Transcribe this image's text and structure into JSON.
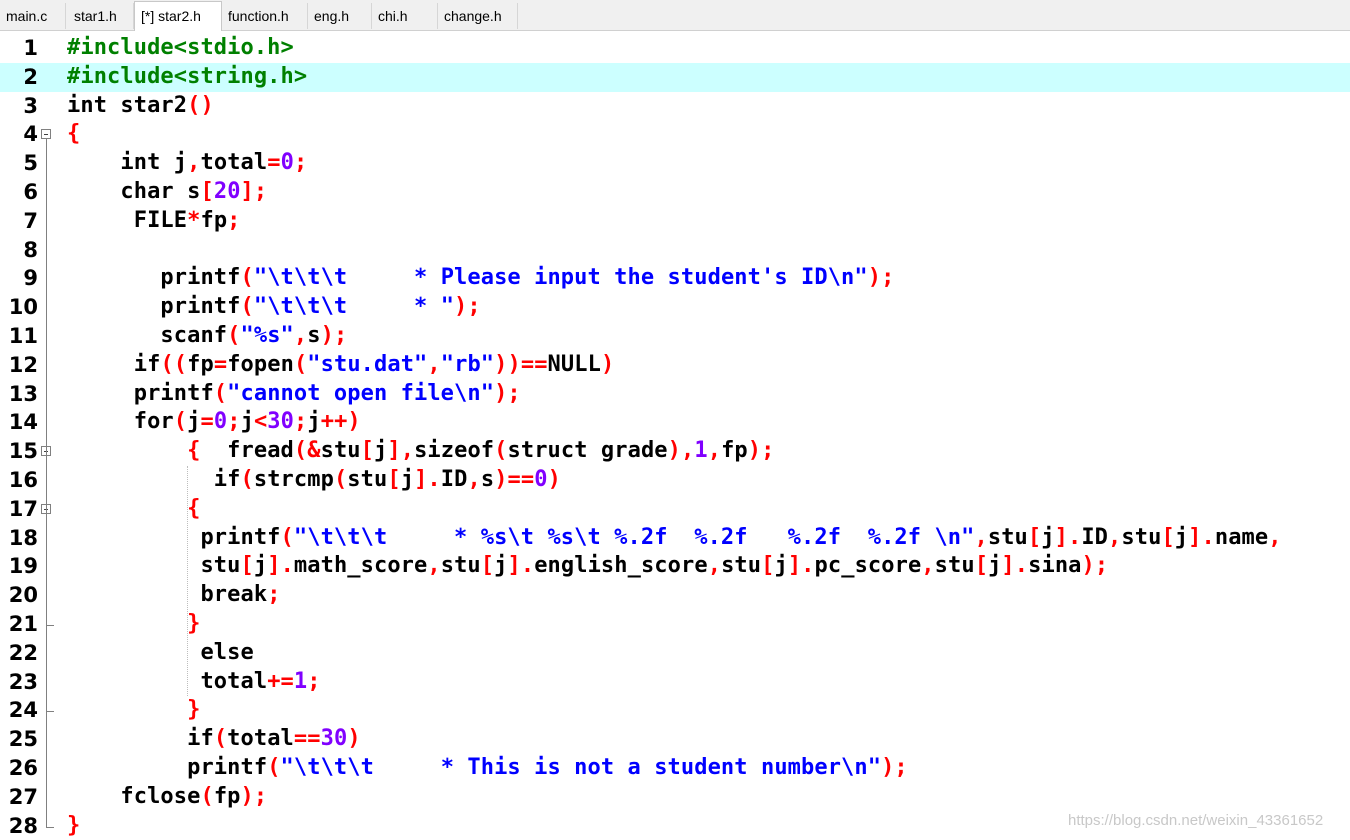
{
  "tabs": [
    {
      "label": "main.c"
    },
    {
      "label": "star1.h"
    },
    {
      "label": "[*] star2.h"
    },
    {
      "label": "function.h"
    },
    {
      "label": "eng.h"
    },
    {
      "label": "chi.h"
    },
    {
      "label": "change.h"
    }
  ],
  "active_tab": 2,
  "highlighted_line": 2,
  "colors": {
    "preprocessor": "#008000",
    "keyword": "#000000",
    "operator": "#ff0000",
    "number": "#8000ff",
    "string": "#0000ff",
    "current_line_bg": "#ccffff"
  },
  "code_lines": [
    {
      "n": "1",
      "tokens": [
        [
          "pp",
          "#include<stdio.h>"
        ]
      ]
    },
    {
      "n": "2",
      "tokens": [
        [
          "pp",
          "#include<string.h>"
        ]
      ]
    },
    {
      "n": "3",
      "tokens": [
        [
          "kw",
          "int"
        ],
        [
          "id",
          " star2"
        ],
        [
          "op",
          "()"
        ]
      ]
    },
    {
      "n": "4",
      "tokens": [
        [
          "op",
          "{"
        ]
      ]
    },
    {
      "n": "5",
      "tokens": [
        [
          "id",
          "    "
        ],
        [
          "kw",
          "int"
        ],
        [
          "id",
          " j"
        ],
        [
          "op",
          ","
        ],
        [
          "id",
          "total"
        ],
        [
          "op",
          "="
        ],
        [
          "num",
          "0"
        ],
        [
          "op",
          ";"
        ]
      ]
    },
    {
      "n": "6",
      "tokens": [
        [
          "id",
          "    "
        ],
        [
          "kw",
          "char"
        ],
        [
          "id",
          " s"
        ],
        [
          "op",
          "["
        ],
        [
          "num",
          "20"
        ],
        [
          "op",
          "];"
        ]
      ]
    },
    {
      "n": "7",
      "tokens": [
        [
          "id",
          "     FILE"
        ],
        [
          "op",
          "*"
        ],
        [
          "id",
          "fp"
        ],
        [
          "op",
          ";"
        ]
      ]
    },
    {
      "n": "8",
      "tokens": []
    },
    {
      "n": "9",
      "tokens": [
        [
          "id",
          "       printf"
        ],
        [
          "op",
          "("
        ],
        [
          "str",
          "\"\\t\\t\\t     * Please input the student's ID\\n\""
        ],
        [
          "op",
          ");"
        ]
      ]
    },
    {
      "n": "10",
      "tokens": [
        [
          "id",
          "       printf"
        ],
        [
          "op",
          "("
        ],
        [
          "str",
          "\"\\t\\t\\t     * \""
        ],
        [
          "op",
          ");"
        ]
      ]
    },
    {
      "n": "11",
      "tokens": [
        [
          "id",
          "       scanf"
        ],
        [
          "op",
          "("
        ],
        [
          "str",
          "\"%s\""
        ],
        [
          "op",
          ","
        ],
        [
          "id",
          "s"
        ],
        [
          "op",
          ");"
        ]
      ]
    },
    {
      "n": "12",
      "tokens": [
        [
          "id",
          "     "
        ],
        [
          "kw",
          "if"
        ],
        [
          "op",
          "(("
        ],
        [
          "id",
          "fp"
        ],
        [
          "op",
          "="
        ],
        [
          "id",
          "fopen"
        ],
        [
          "op",
          "("
        ],
        [
          "str",
          "\"stu.dat\""
        ],
        [
          "op",
          ","
        ],
        [
          "str",
          "\"rb\""
        ],
        [
          "op",
          "))=="
        ],
        [
          "id",
          "NULL"
        ],
        [
          "op",
          ")"
        ]
      ]
    },
    {
      "n": "13",
      "tokens": [
        [
          "id",
          "     printf"
        ],
        [
          "op",
          "("
        ],
        [
          "str",
          "\"cannot open file\\n\""
        ],
        [
          "op",
          ");"
        ]
      ]
    },
    {
      "n": "14",
      "tokens": [
        [
          "id",
          "     "
        ],
        [
          "kw",
          "for"
        ],
        [
          "op",
          "("
        ],
        [
          "id",
          "j"
        ],
        [
          "op",
          "="
        ],
        [
          "num",
          "0"
        ],
        [
          "op",
          ";"
        ],
        [
          "id",
          "j"
        ],
        [
          "op",
          "<"
        ],
        [
          "num",
          "30"
        ],
        [
          "op",
          ";"
        ],
        [
          "id",
          "j"
        ],
        [
          "op",
          "++)"
        ]
      ]
    },
    {
      "n": "15",
      "tokens": [
        [
          "id",
          "         "
        ],
        [
          "op",
          "{"
        ],
        [
          "id",
          "  fread"
        ],
        [
          "op",
          "(&"
        ],
        [
          "id",
          "stu"
        ],
        [
          "op",
          "["
        ],
        [
          "id",
          "j"
        ],
        [
          "op",
          "],"
        ],
        [
          "kw",
          "sizeof"
        ],
        [
          "op",
          "("
        ],
        [
          "kw",
          "struct"
        ],
        [
          "id",
          " grade"
        ],
        [
          "op",
          "),"
        ],
        [
          "num",
          "1"
        ],
        [
          "op",
          ","
        ],
        [
          "id",
          "fp"
        ],
        [
          "op",
          ");"
        ]
      ]
    },
    {
      "n": "16",
      "tokens": [
        [
          "id",
          "           "
        ],
        [
          "kw",
          "if"
        ],
        [
          "op",
          "("
        ],
        [
          "id",
          "strcmp"
        ],
        [
          "op",
          "("
        ],
        [
          "id",
          "stu"
        ],
        [
          "op",
          "["
        ],
        [
          "id",
          "j"
        ],
        [
          "op",
          "]."
        ],
        [
          "id",
          "ID"
        ],
        [
          "op",
          ","
        ],
        [
          "id",
          "s"
        ],
        [
          "op",
          ")=="
        ],
        [
          "num",
          "0"
        ],
        [
          "op",
          ")"
        ]
      ]
    },
    {
      "n": "17",
      "tokens": [
        [
          "id",
          "         "
        ],
        [
          "op",
          "{"
        ]
      ]
    },
    {
      "n": "18",
      "tokens": [
        [
          "id",
          "          printf"
        ],
        [
          "op",
          "("
        ],
        [
          "str",
          "\"\\t\\t\\t     * %s\\t %s\\t %.2f  %.2f   %.2f  %.2f \\n\""
        ],
        [
          "op",
          ","
        ],
        [
          "id",
          "stu"
        ],
        [
          "op",
          "["
        ],
        [
          "id",
          "j"
        ],
        [
          "op",
          "]."
        ],
        [
          "id",
          "ID"
        ],
        [
          "op",
          ","
        ],
        [
          "id",
          "stu"
        ],
        [
          "op",
          "["
        ],
        [
          "id",
          "j"
        ],
        [
          "op",
          "]."
        ],
        [
          "id",
          "name"
        ],
        [
          "op",
          ","
        ]
      ]
    },
    {
      "n": "19",
      "tokens": [
        [
          "id",
          "          stu"
        ],
        [
          "op",
          "["
        ],
        [
          "id",
          "j"
        ],
        [
          "op",
          "]."
        ],
        [
          "id",
          "math_score"
        ],
        [
          "op",
          ","
        ],
        [
          "id",
          "stu"
        ],
        [
          "op",
          "["
        ],
        [
          "id",
          "j"
        ],
        [
          "op",
          "]."
        ],
        [
          "id",
          "english_score"
        ],
        [
          "op",
          ","
        ],
        [
          "id",
          "stu"
        ],
        [
          "op",
          "["
        ],
        [
          "id",
          "j"
        ],
        [
          "op",
          "]."
        ],
        [
          "id",
          "pc_score"
        ],
        [
          "op",
          ","
        ],
        [
          "id",
          "stu"
        ],
        [
          "op",
          "["
        ],
        [
          "id",
          "j"
        ],
        [
          "op",
          "]."
        ],
        [
          "id",
          "sina"
        ],
        [
          "op",
          ");"
        ]
      ]
    },
    {
      "n": "20",
      "tokens": [
        [
          "id",
          "          "
        ],
        [
          "kw",
          "break"
        ],
        [
          "op",
          ";"
        ]
      ]
    },
    {
      "n": "21",
      "tokens": [
        [
          "id",
          "         "
        ],
        [
          "op",
          "}"
        ]
      ]
    },
    {
      "n": "22",
      "tokens": [
        [
          "id",
          "          "
        ],
        [
          "kw",
          "else"
        ]
      ]
    },
    {
      "n": "23",
      "tokens": [
        [
          "id",
          "          total"
        ],
        [
          "op",
          "+="
        ],
        [
          "num",
          "1"
        ],
        [
          "op",
          ";"
        ]
      ]
    },
    {
      "n": "24",
      "tokens": [
        [
          "id",
          "         "
        ],
        [
          "op",
          "}"
        ]
      ]
    },
    {
      "n": "25",
      "tokens": [
        [
          "id",
          "         "
        ],
        [
          "kw",
          "if"
        ],
        [
          "op",
          "("
        ],
        [
          "id",
          "total"
        ],
        [
          "op",
          "=="
        ],
        [
          "num",
          "30"
        ],
        [
          "op",
          ")"
        ]
      ]
    },
    {
      "n": "26",
      "tokens": [
        [
          "id",
          "         printf"
        ],
        [
          "op",
          "("
        ],
        [
          "str",
          "\"\\t\\t\\t     * This is not a student number\\n\""
        ],
        [
          "op",
          ");"
        ]
      ]
    },
    {
      "n": "27",
      "tokens": [
        [
          "id",
          "    fclose"
        ],
        [
          "op",
          "("
        ],
        [
          "id",
          "fp"
        ],
        [
          "op",
          ");"
        ]
      ]
    },
    {
      "n": "28",
      "tokens": [
        [
          "op",
          "}"
        ]
      ]
    }
  ],
  "watermark": "https://blog.csdn.net/weixin_43361652"
}
